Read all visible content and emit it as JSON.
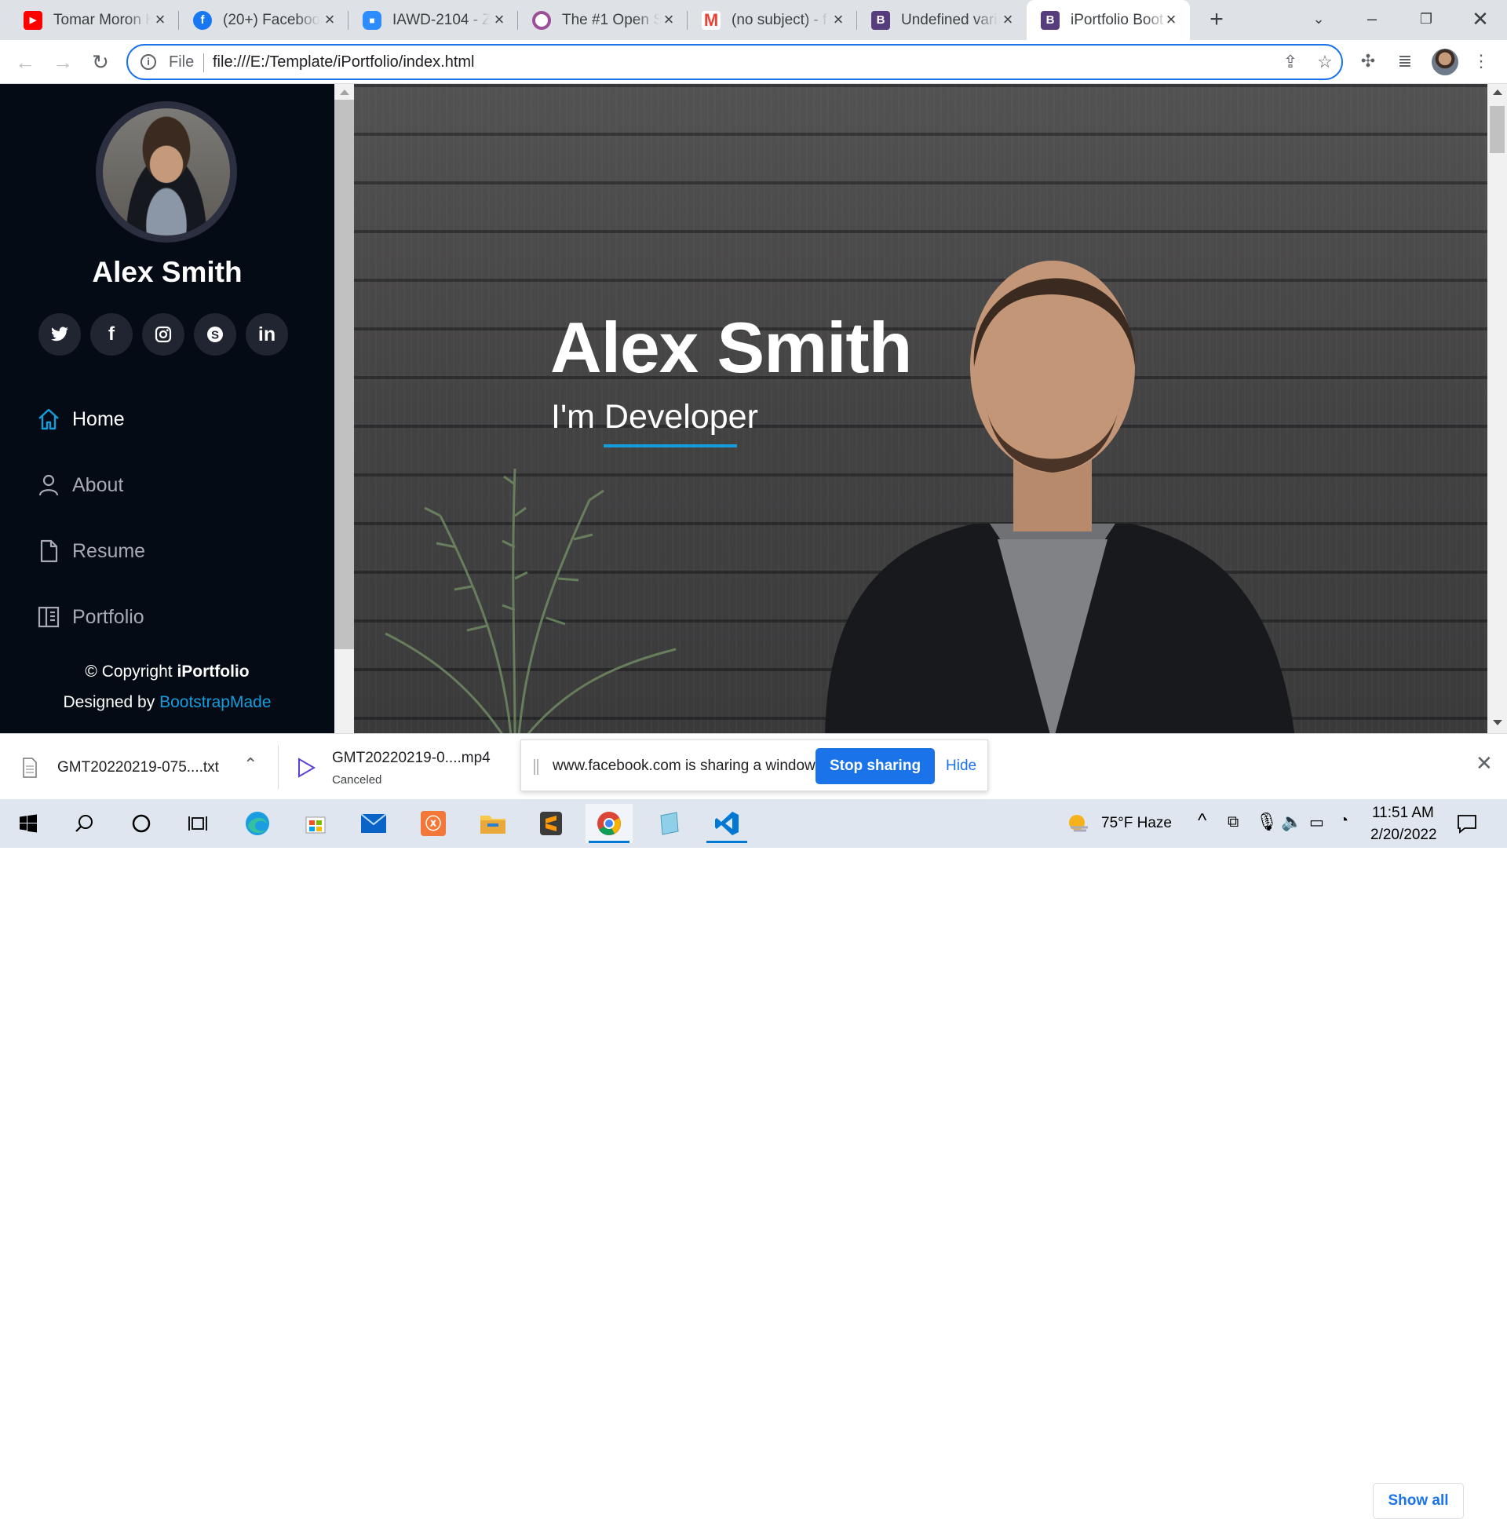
{
  "browser": {
    "tabs": [
      {
        "title": "Tomar Moron K",
        "icon": "youtube-icon",
        "color": "#ff0000"
      },
      {
        "title": "(20+) Facebook",
        "icon": "facebook-icon",
        "color": "#1877f2"
      },
      {
        "title": "IAWD-2104 - Z",
        "icon": "zoom-icon",
        "color": "#2d8cff"
      },
      {
        "title": "The #1 Open S",
        "icon": "opensource-icon",
        "color": "#9b4f96"
      },
      {
        "title": "(no subject) - f",
        "icon": "gmail-icon",
        "color": "#ea4335"
      },
      {
        "title": "Undefined vari",
        "icon": "bootstrap-icon",
        "color": "#563d7c"
      },
      {
        "title": "iPortfolio Boot",
        "icon": "bootstrap-icon",
        "color": "#563d7c"
      }
    ],
    "address": {
      "scheme": "File",
      "url": "file:///E:/Template/iPortfolio/index.html"
    }
  },
  "sidebar": {
    "name": "Alex Smith",
    "social": [
      {
        "icon": "twitter-icon",
        "glyph": "🐦"
      },
      {
        "icon": "facebook-icon",
        "glyph": "f"
      },
      {
        "icon": "instagram-icon",
        "glyph": "◎"
      },
      {
        "icon": "skype-icon",
        "glyph": "S"
      },
      {
        "icon": "linkedin-icon",
        "glyph": "in"
      }
    ],
    "nav": [
      {
        "label": "Home",
        "icon": "home-icon",
        "active": true
      },
      {
        "label": "About",
        "icon": "person-icon",
        "active": false
      },
      {
        "label": "Resume",
        "icon": "file-icon",
        "active": false
      },
      {
        "label": "Portfolio",
        "icon": "book-icon",
        "active": false
      }
    ],
    "footer": {
      "copyright_prefix": "© Copyright ",
      "copyright_brand": "iPortfolio",
      "designed_prefix": "Designed by ",
      "designed_link": "BootstrapMade"
    }
  },
  "hero": {
    "name": "Alex Smith",
    "role": "I'm Developer",
    "accent": "#149ddd"
  },
  "downloads": {
    "items": [
      {
        "name": "GMT20220219-075....txt",
        "status": ""
      },
      {
        "name": "GMT20220219-0....mp4",
        "status": "Canceled"
      }
    ],
    "share_message": "www.facebook.com is sharing a window.",
    "stop_sharing": "Stop sharing",
    "hide": "Hide",
    "show_all": "Show all"
  },
  "taskbar": {
    "weather": "75°F  Haze",
    "time": "11:51 AM",
    "date": "2/20/2022"
  }
}
